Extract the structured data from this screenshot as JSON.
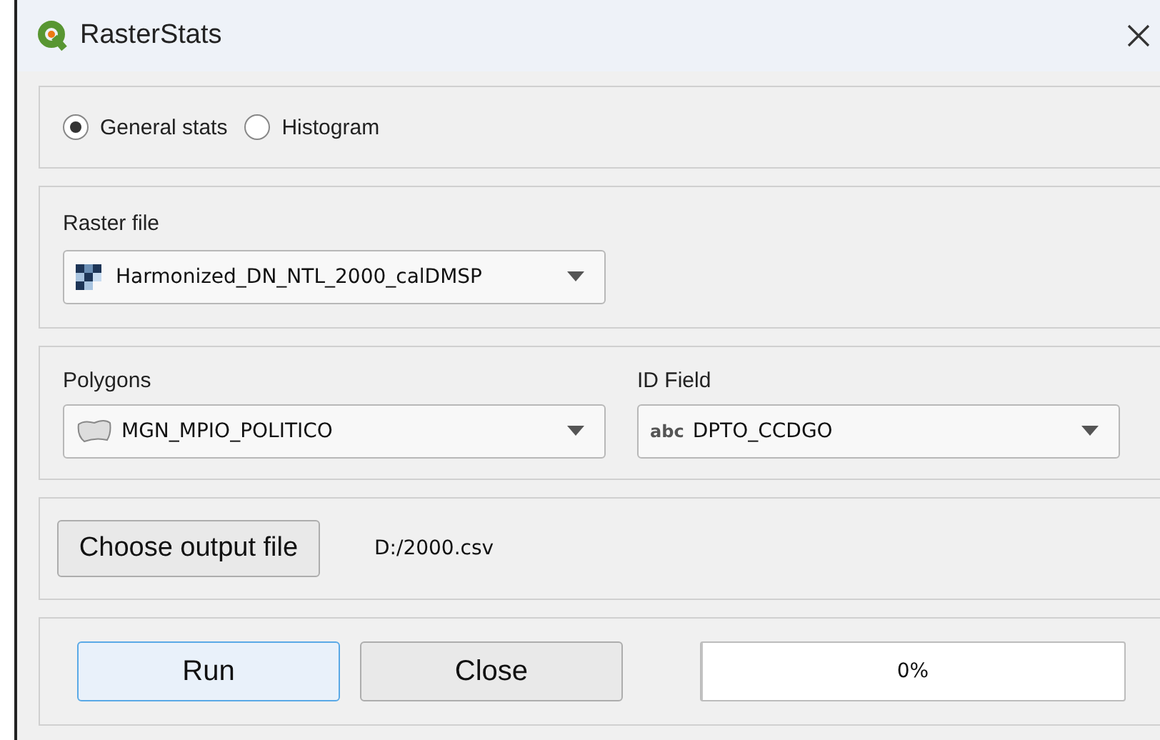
{
  "window": {
    "title": "RasterStats"
  },
  "mode_options": [
    {
      "label": "General stats",
      "selected": true
    },
    {
      "label": "Histogram",
      "selected": false
    }
  ],
  "raster": {
    "label": "Raster file",
    "value": "Harmonized_DN_NTL_2000_calDMSP"
  },
  "polygons": {
    "label": "Polygons",
    "value": "MGN_MPIO_POLITICO"
  },
  "id_field": {
    "label": "ID Field",
    "type_tag": "abc",
    "value": "DPTO_CCDGO"
  },
  "output": {
    "button": "Choose output file",
    "path": "D:/2000.csv"
  },
  "buttons": [
    {
      "label": "Run",
      "kind": "default"
    },
    {
      "label": "Close",
      "kind": "normal"
    }
  ],
  "progress": {
    "level": 0,
    "reading": "0%"
  }
}
